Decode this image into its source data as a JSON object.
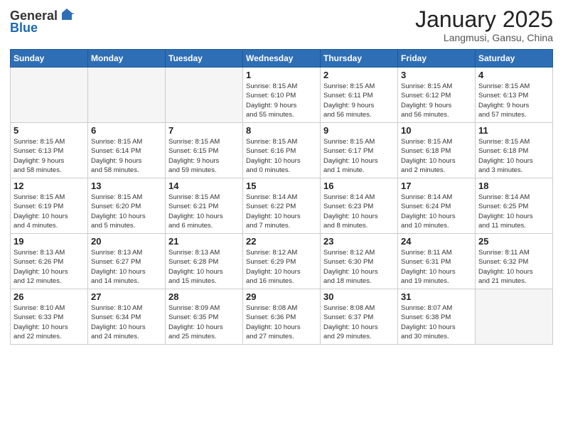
{
  "header": {
    "logo_general": "General",
    "logo_blue": "Blue",
    "month_title": "January 2025",
    "subtitle": "Langmusi, Gansu, China"
  },
  "weekdays": [
    "Sunday",
    "Monday",
    "Tuesday",
    "Wednesday",
    "Thursday",
    "Friday",
    "Saturday"
  ],
  "weeks": [
    [
      {
        "day": "",
        "info": "",
        "empty": true
      },
      {
        "day": "",
        "info": "",
        "empty": true
      },
      {
        "day": "",
        "info": "",
        "empty": true
      },
      {
        "day": "1",
        "info": "Sunrise: 8:15 AM\nSunset: 6:10 PM\nDaylight: 9 hours\nand 55 minutes."
      },
      {
        "day": "2",
        "info": "Sunrise: 8:15 AM\nSunset: 6:11 PM\nDaylight: 9 hours\nand 56 minutes."
      },
      {
        "day": "3",
        "info": "Sunrise: 8:15 AM\nSunset: 6:12 PM\nDaylight: 9 hours\nand 56 minutes."
      },
      {
        "day": "4",
        "info": "Sunrise: 8:15 AM\nSunset: 6:13 PM\nDaylight: 9 hours\nand 57 minutes."
      }
    ],
    [
      {
        "day": "5",
        "info": "Sunrise: 8:15 AM\nSunset: 6:13 PM\nDaylight: 9 hours\nand 58 minutes."
      },
      {
        "day": "6",
        "info": "Sunrise: 8:15 AM\nSunset: 6:14 PM\nDaylight: 9 hours\nand 58 minutes."
      },
      {
        "day": "7",
        "info": "Sunrise: 8:15 AM\nSunset: 6:15 PM\nDaylight: 9 hours\nand 59 minutes."
      },
      {
        "day": "8",
        "info": "Sunrise: 8:15 AM\nSunset: 6:16 PM\nDaylight: 10 hours\nand 0 minutes."
      },
      {
        "day": "9",
        "info": "Sunrise: 8:15 AM\nSunset: 6:17 PM\nDaylight: 10 hours\nand 1 minute."
      },
      {
        "day": "10",
        "info": "Sunrise: 8:15 AM\nSunset: 6:18 PM\nDaylight: 10 hours\nand 2 minutes."
      },
      {
        "day": "11",
        "info": "Sunrise: 8:15 AM\nSunset: 6:18 PM\nDaylight: 10 hours\nand 3 minutes."
      }
    ],
    [
      {
        "day": "12",
        "info": "Sunrise: 8:15 AM\nSunset: 6:19 PM\nDaylight: 10 hours\nand 4 minutes."
      },
      {
        "day": "13",
        "info": "Sunrise: 8:15 AM\nSunset: 6:20 PM\nDaylight: 10 hours\nand 5 minutes."
      },
      {
        "day": "14",
        "info": "Sunrise: 8:15 AM\nSunset: 6:21 PM\nDaylight: 10 hours\nand 6 minutes."
      },
      {
        "day": "15",
        "info": "Sunrise: 8:14 AM\nSunset: 6:22 PM\nDaylight: 10 hours\nand 7 minutes."
      },
      {
        "day": "16",
        "info": "Sunrise: 8:14 AM\nSunset: 6:23 PM\nDaylight: 10 hours\nand 8 minutes."
      },
      {
        "day": "17",
        "info": "Sunrise: 8:14 AM\nSunset: 6:24 PM\nDaylight: 10 hours\nand 10 minutes."
      },
      {
        "day": "18",
        "info": "Sunrise: 8:14 AM\nSunset: 6:25 PM\nDaylight: 10 hours\nand 11 minutes."
      }
    ],
    [
      {
        "day": "19",
        "info": "Sunrise: 8:13 AM\nSunset: 6:26 PM\nDaylight: 10 hours\nand 12 minutes."
      },
      {
        "day": "20",
        "info": "Sunrise: 8:13 AM\nSunset: 6:27 PM\nDaylight: 10 hours\nand 14 minutes."
      },
      {
        "day": "21",
        "info": "Sunrise: 8:13 AM\nSunset: 6:28 PM\nDaylight: 10 hours\nand 15 minutes."
      },
      {
        "day": "22",
        "info": "Sunrise: 8:12 AM\nSunset: 6:29 PM\nDaylight: 10 hours\nand 16 minutes."
      },
      {
        "day": "23",
        "info": "Sunrise: 8:12 AM\nSunset: 6:30 PM\nDaylight: 10 hours\nand 18 minutes."
      },
      {
        "day": "24",
        "info": "Sunrise: 8:11 AM\nSunset: 6:31 PM\nDaylight: 10 hours\nand 19 minutes."
      },
      {
        "day": "25",
        "info": "Sunrise: 8:11 AM\nSunset: 6:32 PM\nDaylight: 10 hours\nand 21 minutes."
      }
    ],
    [
      {
        "day": "26",
        "info": "Sunrise: 8:10 AM\nSunset: 6:33 PM\nDaylight: 10 hours\nand 22 minutes."
      },
      {
        "day": "27",
        "info": "Sunrise: 8:10 AM\nSunset: 6:34 PM\nDaylight: 10 hours\nand 24 minutes."
      },
      {
        "day": "28",
        "info": "Sunrise: 8:09 AM\nSunset: 6:35 PM\nDaylight: 10 hours\nand 25 minutes."
      },
      {
        "day": "29",
        "info": "Sunrise: 8:08 AM\nSunset: 6:36 PM\nDaylight: 10 hours\nand 27 minutes."
      },
      {
        "day": "30",
        "info": "Sunrise: 8:08 AM\nSunset: 6:37 PM\nDaylight: 10 hours\nand 29 minutes."
      },
      {
        "day": "31",
        "info": "Sunrise: 8:07 AM\nSunset: 6:38 PM\nDaylight: 10 hours\nand 30 minutes."
      },
      {
        "day": "",
        "info": "",
        "empty": true
      }
    ]
  ]
}
